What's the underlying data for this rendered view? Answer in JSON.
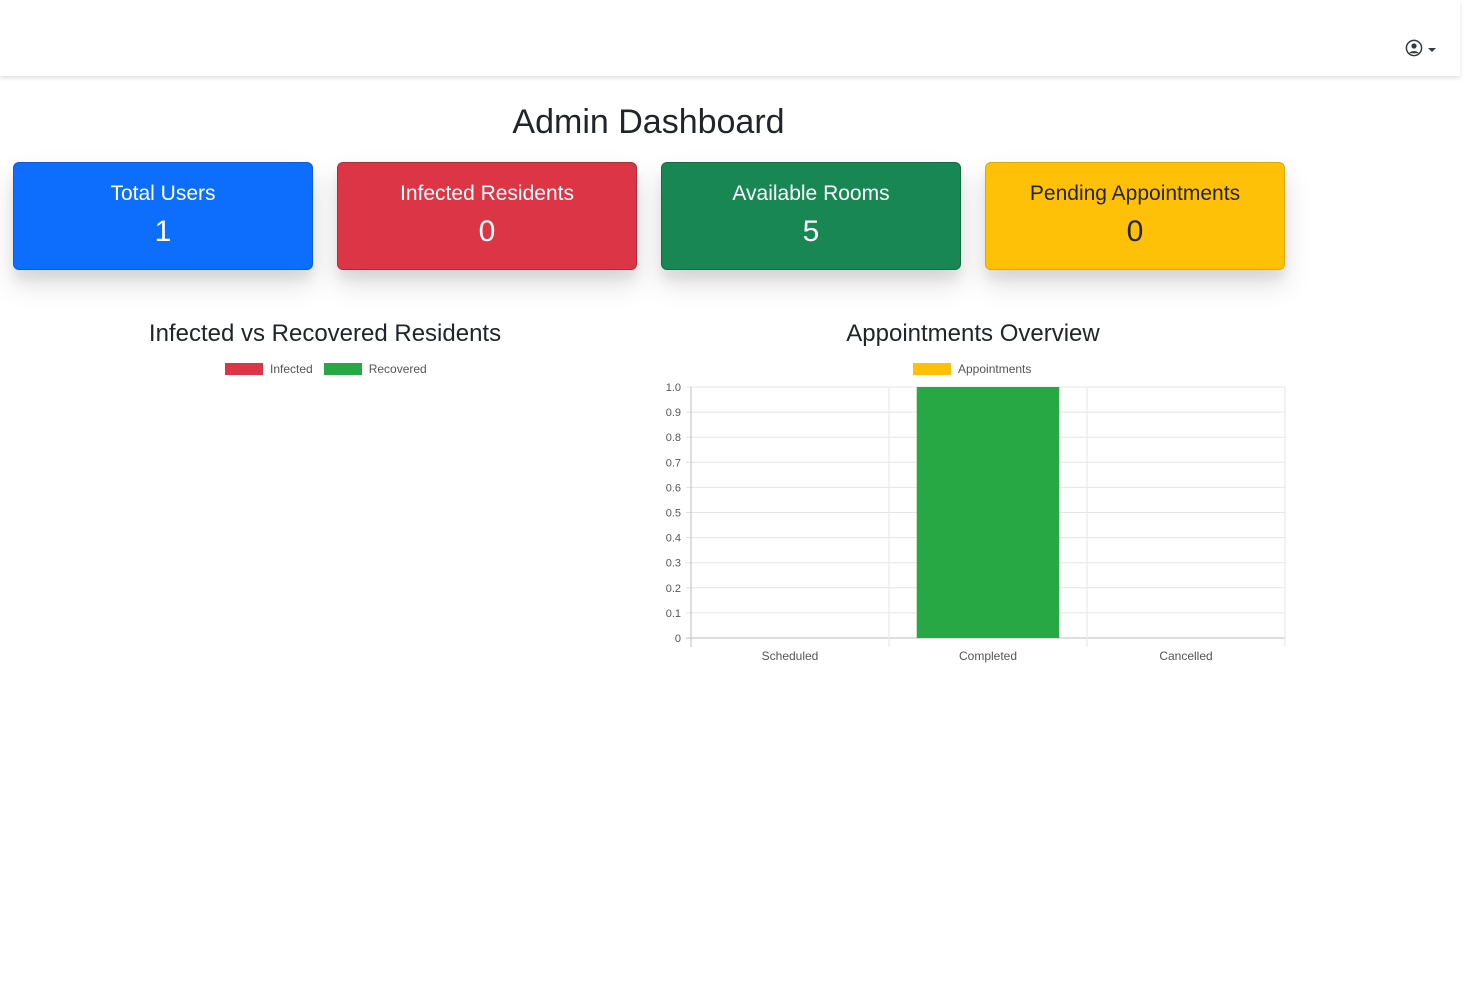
{
  "navbar": {
    "user_icon": "user-circle-icon",
    "caret_icon": "caret-down-icon"
  },
  "page": {
    "title": "Admin Dashboard"
  },
  "cards": [
    {
      "label": "Total Users",
      "value": "1",
      "color": "#0d6efd"
    },
    {
      "label": "Infected Residents",
      "value": "0",
      "color": "#dc3545"
    },
    {
      "label": "Available Rooms",
      "value": "5",
      "color": "#198754"
    },
    {
      "label": "Pending Appointments",
      "value": "0",
      "color": "#ffc107"
    }
  ],
  "charts": {
    "infected": {
      "title": "Infected vs Recovered Residents",
      "legend": [
        {
          "label": "Infected",
          "color": "#dc3545"
        },
        {
          "label": "Recovered",
          "color": "#28a745"
        }
      ]
    },
    "appointments": {
      "title": "Appointments Overview",
      "legend": [
        {
          "label": "Appointments",
          "color": "#ffc107"
        }
      ]
    }
  },
  "chart_data": [
    {
      "type": "pie",
      "title": "Infected vs Recovered Residents",
      "categories": [
        "Infected",
        "Recovered"
      ],
      "values": [
        0,
        0
      ],
      "colors": [
        "#dc3545",
        "#28a745"
      ],
      "legend": "top"
    },
    {
      "type": "bar",
      "title": "Appointments Overview",
      "categories": [
        "Scheduled",
        "Completed",
        "Cancelled"
      ],
      "series": [
        {
          "name": "Appointments",
          "values": [
            0,
            1,
            0
          ]
        }
      ],
      "bar_colors": [
        "#ffc107",
        "#28a745",
        "#dc3545"
      ],
      "ylim": [
        0,
        1
      ],
      "yticks": [
        "0",
        "0.1",
        "0.2",
        "0.3",
        "0.4",
        "0.5",
        "0.6",
        "0.7",
        "0.8",
        "0.9",
        "1.0"
      ],
      "grid": true,
      "legend": "top"
    }
  ]
}
